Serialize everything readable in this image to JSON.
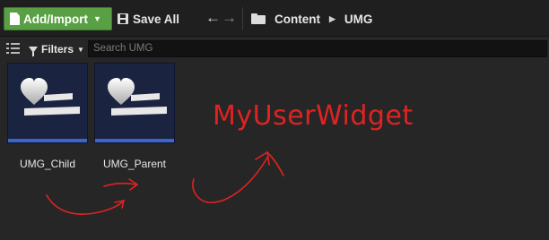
{
  "toolbar": {
    "add_import_label": "Add/Import",
    "save_all_label": "Save All",
    "back_icon": "arrow-left-icon",
    "forward_icon": "arrow-right-icon",
    "breadcrumb": [
      "Content",
      "UMG"
    ]
  },
  "filterbar": {
    "filters_label": "Filters",
    "search_placeholder": "Search UMG"
  },
  "assets": [
    {
      "name": "UMG_Child",
      "icon": "widget-blueprint-icon"
    },
    {
      "name": "UMG_Parent",
      "icon": "widget-blueprint-icon"
    }
  ],
  "annotation": {
    "text": "MyUserWidget",
    "color": "#e12222"
  },
  "colors": {
    "accent_green": "#58a043",
    "asset_bar_blue": "#3b67c9",
    "background": "#262626"
  }
}
